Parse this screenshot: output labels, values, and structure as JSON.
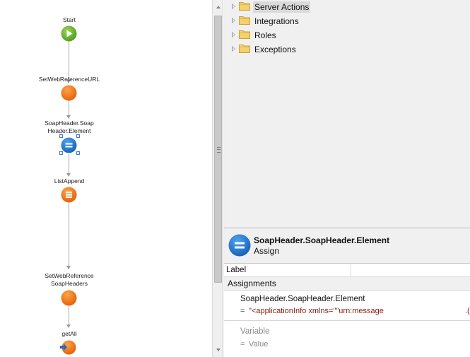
{
  "flow": {
    "start_label": "Start",
    "node1_label": "SetWebReferenceURL",
    "node2_label_line1": "SoapHeader.Soap",
    "node2_label_line2": "Header.Element",
    "node3_label": "ListAppend",
    "node4_label_line1": "SetWebReference",
    "node4_label_line2": "SoapHeaders",
    "node5_label": "getAll"
  },
  "tree": {
    "items": [
      {
        "label": "Server Actions",
        "icon": "folder-icon",
        "highlighted": true
      },
      {
        "label": "Integrations",
        "icon": "folder-icon",
        "highlighted": false
      },
      {
        "label": "Roles",
        "icon": "folder-icon",
        "highlighted": false
      },
      {
        "label": "Exceptions",
        "icon": "folder-icon",
        "highlighted": false
      }
    ]
  },
  "properties": {
    "title": "SoapHeader.SoapHeader.Element",
    "subtitle": "Assign",
    "label_field": "Label",
    "label_value": "",
    "assignments_header": "Assignments",
    "assignments": [
      {
        "variable": "SoapHeader.SoapHeader.Element",
        "eq": "=",
        "value": "\"<applicationInfo xmlns=\"\"urn:message",
        "value_tail": ".("
      },
      {
        "variable": "Variable",
        "eq": "=",
        "value": "Value",
        "placeholder": true
      }
    ]
  },
  "colors": {
    "start_green": "#5aa51c",
    "action_orange": "#ef6c0c",
    "assign_blue": "#1b6fc4",
    "string_red": "#8b1a10",
    "folder_yellow": "#f2c94c"
  }
}
